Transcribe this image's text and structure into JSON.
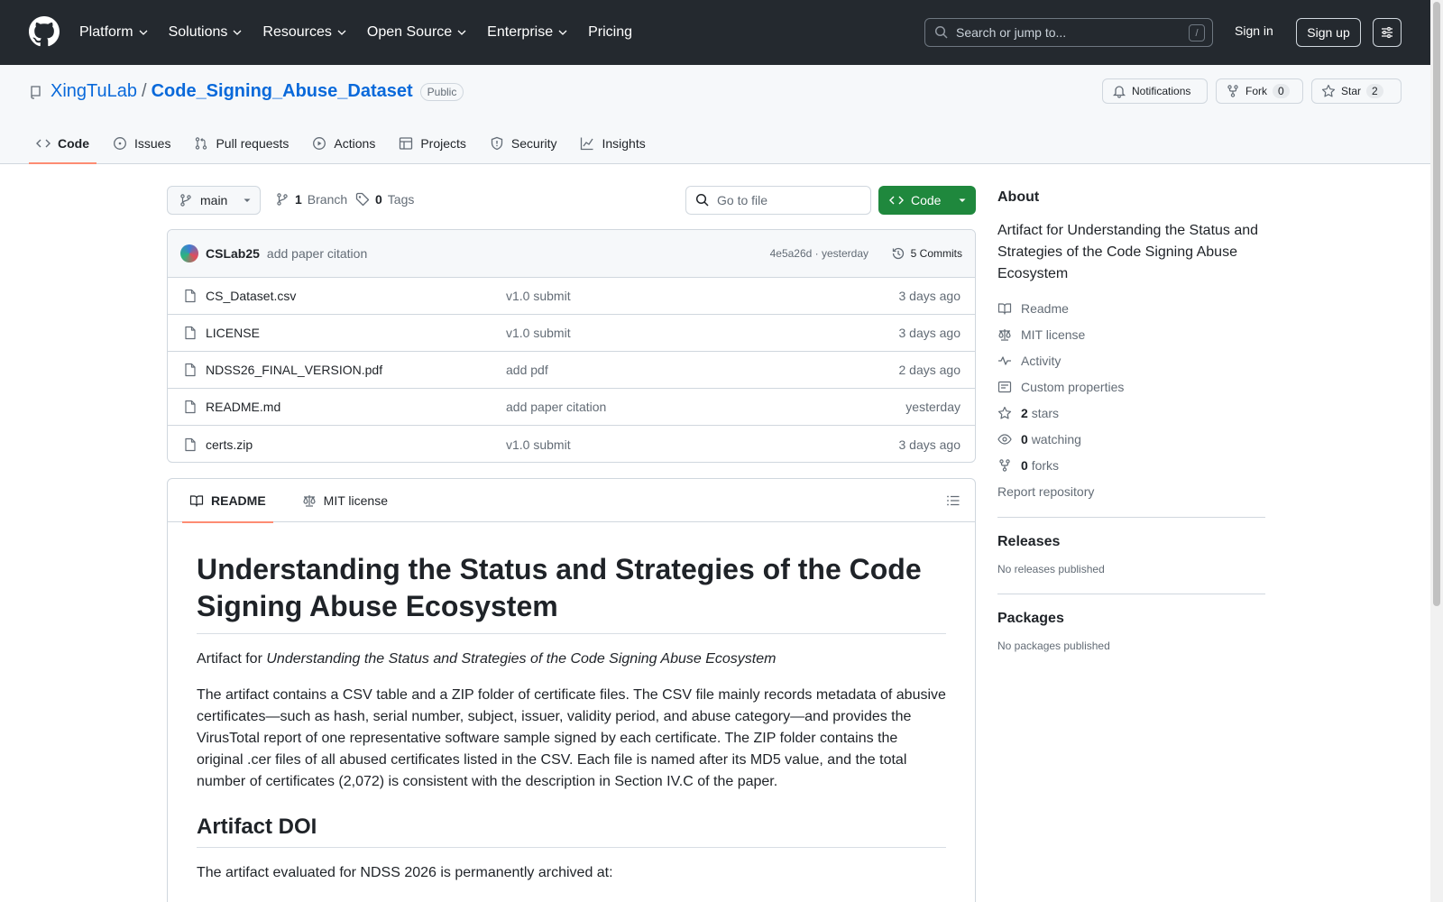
{
  "header": {
    "nav": [
      "Platform",
      "Solutions",
      "Resources",
      "Open Source",
      "Enterprise",
      "Pricing"
    ],
    "search_placeholder": "Search or jump to...",
    "search_shortcut": "/",
    "signin": "Sign in",
    "signup": "Sign up"
  },
  "repo": {
    "owner": "XingTuLab",
    "separator": "/",
    "name": "Code_Signing_Abuse_Dataset",
    "visibility": "Public",
    "notifications_label": "Notifications",
    "fork_label": "Fork",
    "fork_count": "0",
    "star_label": "Star",
    "star_count": "2",
    "tabs": [
      "Code",
      "Issues",
      "Pull requests",
      "Actions",
      "Projects",
      "Security",
      "Insights"
    ]
  },
  "toolbar": {
    "branch": "main",
    "branch_count": "1",
    "branch_label": "Branch",
    "tag_count": "0",
    "tag_label": "Tags",
    "goto_placeholder": "Go to file",
    "code_label": "Code"
  },
  "commit": {
    "author": "CSLab25",
    "message": "add paper citation",
    "hash_time": "4e5a26d · yesterday",
    "commits_label": "5 Commits"
  },
  "files": [
    {
      "name": "CS_Dataset.csv",
      "msg": "v1.0 submit",
      "time": "3 days ago"
    },
    {
      "name": "LICENSE",
      "msg": "v1.0 submit",
      "time": "3 days ago"
    },
    {
      "name": "NDSS26_FINAL_VERSION.pdf",
      "msg": "add pdf",
      "time": "2 days ago"
    },
    {
      "name": "README.md",
      "msg": "add paper citation",
      "time": "yesterday"
    },
    {
      "name": "certs.zip",
      "msg": "v1.0 submit",
      "time": "3 days ago"
    }
  ],
  "readme": {
    "tab_readme": "README",
    "tab_license": "MIT license",
    "title": "Understanding the Status and Strategies of the Code Signing Abuse Ecosystem",
    "intro_prefix": "Artifact for ",
    "intro_em": "Understanding the Status and Strategies of the Code Signing Abuse Ecosystem",
    "body": "The artifact contains a CSV table and a ZIP folder of certificate files. The CSV file mainly records metadata of abusive certificates—such as hash, serial number, subject, issuer, validity period, and abuse category—and provides the VirusTotal report of one representative software sample signed by each certificate. The ZIP folder contains the original .cer files of all abused certificates listed in the CSV. Each file is named after its MD5 value, and the total number of certificates (2,072) is consistent with the description in Section IV.C of the paper.",
    "h2": "Artifact DOI",
    "doi_text": "The artifact evaluated for NDSS 2026 is permanently archived at:"
  },
  "about": {
    "title": "About",
    "description": "Artifact for Understanding the Status and Strategies of the Code Signing Abuse Ecosystem",
    "readme": "Readme",
    "license": "MIT license",
    "activity": "Activity",
    "custom": "Custom properties",
    "stars_n": "2",
    "stars": "stars",
    "watching_n": "0",
    "watching": "watching",
    "forks_n": "0",
    "forks": "forks",
    "report": "Report repository"
  },
  "releases": {
    "title": "Releases",
    "none": "No releases published"
  },
  "packages": {
    "title": "Packages",
    "none": "No packages published"
  }
}
